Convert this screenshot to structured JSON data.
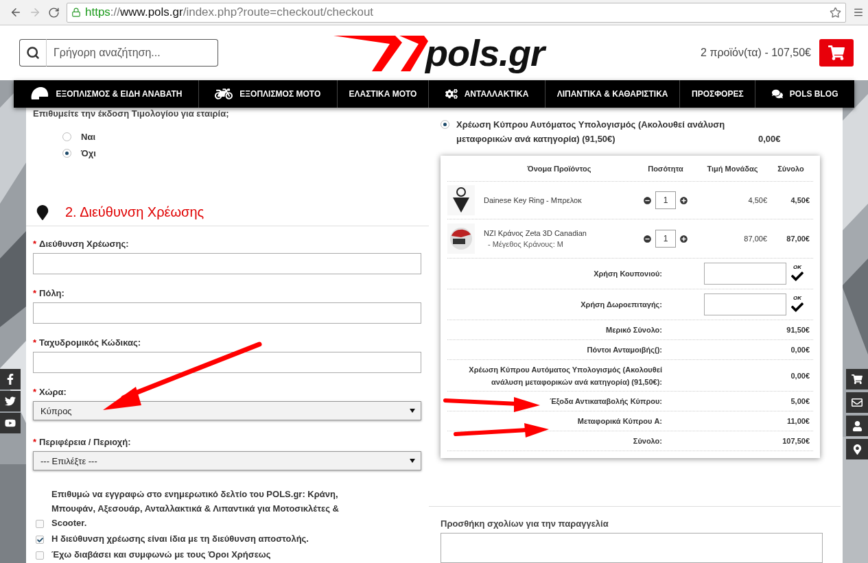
{
  "browser": {
    "url": [
      {
        "kind": "scheme",
        "text": "https"
      },
      {
        "kind": "sep",
        "text": "://"
      },
      {
        "kind": "host",
        "text": "www.pols.gr"
      },
      {
        "kind": "path",
        "text": "/index.php?route=checkout/checkout"
      }
    ]
  },
  "header": {
    "search_placeholder": "Γρήγορη αναζήτηση...",
    "logo": "pols.gr",
    "cart_summary": "2 προϊόν(τα) - 107,50€"
  },
  "nav": [
    {
      "label": "ΕΞΟΠΛΙΣΜΟΣ & ΕΙΔΗ ΑΝΑΒΑΤΗ",
      "kind": "helmet"
    },
    {
      "label": "ΕΞΟΠΛΙΣΜΟΣ ΜΟΤΟ",
      "kind": "motorcycle"
    },
    {
      "label": "ΕΛΑΣΤΙΚΑ ΜΟΤΟ",
      "kind": "plain"
    },
    {
      "label": "ΑΝΤΑΛΛΑΚΤΙΚΑ",
      "kind": "gears"
    },
    {
      "label": "ΛΙΠΑΝΤΙΚΑ & ΚΑΘΑΡΙΣΤΙΚΑ",
      "kind": "plain"
    },
    {
      "label": "ΠΡΟΣΦΟΡΕΣ",
      "kind": "plain"
    },
    {
      "label": "POLS BLOG",
      "kind": "chat"
    }
  ],
  "invoice": {
    "question": "Επιθυμείτε την έκδοση Τιμολογίου για εταιρία;",
    "options": [
      {
        "label": "Ναι",
        "selected": false
      },
      {
        "label": "Όχι",
        "selected": true
      }
    ]
  },
  "billing": {
    "heading": "2. Διεύθυνση Χρέωσης",
    "fields": [
      {
        "kind": "text",
        "required_mark": "*",
        "label": "Διεύθυνση Χρέωσης:"
      },
      {
        "kind": "text",
        "required_mark": "*",
        "label": "Πόλη:"
      },
      {
        "kind": "text",
        "required_mark": "*",
        "label": "Ταχυδρομικός Κώδικας:"
      },
      {
        "kind": "select",
        "required_mark": "*",
        "label": "Χώρα:",
        "value": "Κύπρος"
      },
      {
        "kind": "select",
        "required_mark": "*",
        "label": "Περιφέρεια / Περιοχή:",
        "value": "--- Επιλέξτε ---"
      }
    ],
    "checkboxes": [
      {
        "label": "Επιθυμώ να εγγραφώ στο ενημερωτικό δελτίο του POLS.gr: Κράνη, Μπουφάν, Αξεσουάρ, Ανταλλακτικά & Λιπαντικά για Μοτοσικλέτες & Scooter.",
        "checked": false
      },
      {
        "label": "Η διεύθυνση χρέωσης είναι ίδια με τη διεύθυνση αποστολής.",
        "checked": true
      },
      {
        "label": "Έχω διαβάσει και συμφωνώ με τους Όροι Χρήσεως",
        "checked": false
      }
    ]
  },
  "shipping_option": {
    "label": "Χρέωση Κύπρου Αυτόματος Υπολογισμός (Ακολουθεί ανάλυση μεταφορικών ανά κατηγορία) (91,50€)",
    "price": "0,00€",
    "selected": true
  },
  "cart": {
    "columns": [
      "Όνομα Προϊόντος",
      "Ποσότητα",
      "Τιμή Μονάδας",
      "Σύνολο"
    ],
    "items": [
      {
        "kind": "keyring",
        "name": "Dainese Key Ring",
        "suffix": " - Μπρελοκ",
        "qty": "1",
        "unit_price": "4,50€",
        "total": "4,50€"
      },
      {
        "kind": "helmet",
        "name": "NZI Κράνος Zeta 3D Canadian",
        "option": "- Μέγεθος Κράνους: M",
        "qty": "1",
        "unit_price": "87,00€",
        "total": "87,00€"
      }
    ],
    "vouchers": [
      {
        "label": "Χρήση Κουπονιού:",
        "button": "OK"
      },
      {
        "label": "Χρήση Δωροεπιταγής:",
        "button": "OK"
      }
    ],
    "totals": [
      {
        "label": "Μερικό Σύνολο:",
        "value": "91,50€"
      },
      {
        "label": "Πόντοι Ανταμοιβής():",
        "value": "0,00€"
      },
      {
        "label": "Χρέωση Κύπρου Αυτόματος Υπολογισμός (Ακολουθεί ανάλυση μεταφορικών ανά κατηγορία) (91,50€):",
        "value": "0,00€"
      },
      {
        "label": "Έξοδα Αντικαταβολής Κύπρου:",
        "value": "5,00€"
      },
      {
        "label": "Μεταφορικά Κύπρου A:",
        "value": "11,00€"
      },
      {
        "label": "Σύνολο:",
        "value": "107,50€"
      }
    ]
  },
  "comments": {
    "label": "Προσθήκη σχολίων για την παραγγελία"
  }
}
